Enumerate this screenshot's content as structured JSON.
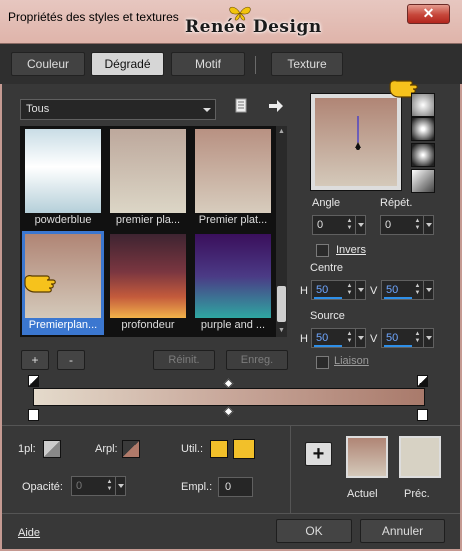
{
  "window": {
    "title": "Propriétés des styles et textures",
    "brand": "Renée Design",
    "close_glyph": "✕"
  },
  "tabs": [
    {
      "label": "Couleur",
      "active": false
    },
    {
      "label": "Dégradé",
      "active": true
    },
    {
      "label": "Motif",
      "active": false
    },
    {
      "label": "Texture",
      "active": false
    }
  ],
  "category_select": {
    "value": "Tous"
  },
  "gradients": [
    {
      "label": "powderblue",
      "selected": false
    },
    {
      "label": "premier pla...",
      "selected": false
    },
    {
      "label": "Premier plat...",
      "selected": false
    },
    {
      "label": "Premierplan...",
      "selected": true
    },
    {
      "label": "profondeur",
      "selected": false
    },
    {
      "label": "purple and ...",
      "selected": false
    }
  ],
  "list_buttons": {
    "add": "+",
    "remove": "-",
    "reset": "Réinit.",
    "save": "Enreg."
  },
  "angle": {
    "label": "Angle",
    "value": "0"
  },
  "repeat": {
    "label": "Répét.",
    "value": "0"
  },
  "invert": {
    "label": "Invers",
    "checked": false
  },
  "center": {
    "label": "Centre",
    "h_label": "H",
    "h_value": "50",
    "v_label": "V",
    "v_value": "50"
  },
  "source": {
    "label": "Source",
    "h_label": "H",
    "h_value": "50",
    "v_label": "V",
    "v_value": "50"
  },
  "link": {
    "label": "Liaison",
    "checked": false
  },
  "gradient_bar": {
    "start_color": "#e4dacb",
    "mid_color": "#c8a79a",
    "end_color": "#a97a6b",
    "midpoint_percent": 50
  },
  "marker_settings": {
    "fg_label": "1pl:",
    "bg_label": "Arpl:",
    "user_label": "Util.:",
    "opacity_label": "Opacité:",
    "opacity_value": "0",
    "location_label": "Empl.:",
    "location_value": "0",
    "user_color": "#f2c02a"
  },
  "swatches": {
    "current_label": "Actuel",
    "previous_label": "Préc.",
    "add_glyph": "+",
    "current_color": "#b08575",
    "previous_color": "#d7d2c4"
  },
  "footer": {
    "help_label": "Aide",
    "ok_label": "OK",
    "cancel_label": "Annuler"
  },
  "colors": {
    "accent": "#3b77d0",
    "titlebar": "#e0b8ae",
    "panel": "#383838"
  }
}
